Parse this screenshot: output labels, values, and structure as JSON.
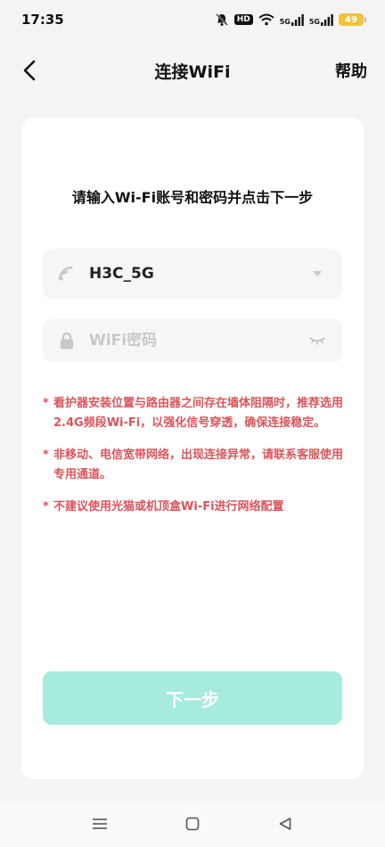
{
  "status_bar": {
    "time": "17:35",
    "hd_label": "HD",
    "signal_label_1": "5G",
    "signal_label_2": "5G",
    "battery": "49",
    "icons": [
      "bell-muted-icon",
      "hd-icon",
      "wifi-icon",
      "signal-icon",
      "signal-icon",
      "battery-icon"
    ]
  },
  "nav": {
    "title": "连接WiFi",
    "help": "帮助",
    "back_icon": "chevron-left-icon"
  },
  "card": {
    "instruction": "请输入Wi-Fi账号和密码并点击下一步",
    "ssid_field": {
      "value": "H3C_5G",
      "lead_icon": "wifi-icon",
      "trail_icon": "dropdown-arrow-icon"
    },
    "password_field": {
      "placeholder": "WiFi密码",
      "value": "",
      "lead_icon": "lock-icon",
      "trail_icon": "eye-closed-icon"
    },
    "notes": [
      {
        "marker": "*",
        "text": "看护器安装位置与路由器之间存在墙体阻隔时，推荐选用2.4G频段Wi-Fi，以强化信号穿透，确保连接稳定。"
      },
      {
        "marker": "*",
        "text": "非移动、电信宽带网络，出现连接异常，请联系客服使用专用通道。"
      },
      {
        "marker": "*",
        "text": "不建议使用光猫或机顶盒Wi-Fi进行网络配置"
      }
    ],
    "next_button": "下一步"
  },
  "colors": {
    "note_red": "#d9555b",
    "button_mint": "#a7eade",
    "battery_yellow": "#f2c33a"
  },
  "system_nav": {
    "icons": [
      "menu-icon",
      "home-icon",
      "back-triangle-icon"
    ]
  }
}
